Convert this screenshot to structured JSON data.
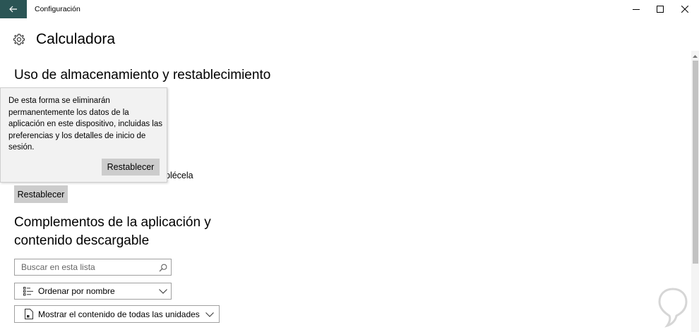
{
  "window": {
    "title": "Configuración"
  },
  "page": {
    "title": "Calculadora"
  },
  "storage": {
    "heading": "Uso de almacenamiento y restablecimiento",
    "partial_text": "plécela",
    "reset_label": "Restablecer"
  },
  "flyout": {
    "text": "De esta forma se eliminarán permanentemente los datos de la aplicación en este dispositivo, incluidas las preferencias y los detalles de inicio de sesión.",
    "reset_label": "Restablecer"
  },
  "addons": {
    "heading_line1": "Complementos de la aplicación y",
    "heading_line2": "contenido descargable",
    "search_placeholder": "Buscar en esta lista",
    "sort_value": "Ordenar por nombre",
    "filter_value": "Mostrar el contenido de todas las unidades"
  },
  "colors": {
    "accent_back": "#2b5555",
    "button": "#cccccc",
    "flyout_bg": "#f2f2f2"
  },
  "icons": [
    "back-arrow-icon",
    "minimize-icon",
    "maximize-icon",
    "close-icon",
    "gear-icon",
    "search-icon",
    "sort-icon",
    "chevron-down-icon",
    "drive-icon"
  ]
}
